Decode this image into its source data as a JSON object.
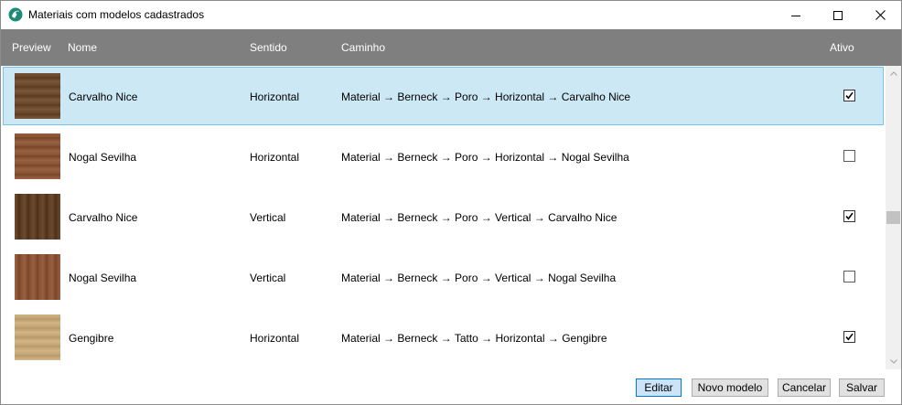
{
  "window": {
    "title": "Materiais com modelos cadastrados",
    "icon": "app-logo-icon"
  },
  "table": {
    "columns": {
      "preview": "Preview",
      "nome": "Nome",
      "sentido": "Sentido",
      "caminho": "Caminho",
      "ativo": "Ativo"
    },
    "rows": [
      {
        "nome": "Carvalho Nice",
        "sentido": "Horizontal",
        "caminho": "Material → Berneck → Poro → Horizontal → Carvalho Nice",
        "ativo": true,
        "selected": true,
        "swatch": "#6b4a2e"
      },
      {
        "nome": "Nogal Sevilha",
        "sentido": "Horizontal",
        "caminho": "Material → Berneck → Poro → Horizontal → Nogal Sevilha",
        "ativo": false,
        "selected": false,
        "swatch": "#8a5637"
      },
      {
        "nome": "Carvalho Nice",
        "sentido": "Vertical",
        "caminho": "Material → Berneck → Poro → Vertical → Carvalho Nice",
        "ativo": true,
        "selected": false,
        "swatch": "#5e3f25"
      },
      {
        "nome": "Nogal Sevilha",
        "sentido": "Vertical",
        "caminho": "Material → Berneck → Poro → Vertical → Nogal Sevilha",
        "ativo": false,
        "selected": false,
        "swatch": "#8b5437"
      },
      {
        "nome": "Gengibre",
        "sentido": "Horizontal",
        "caminho": "Material → Berneck → Tatto → Horizontal → Gengibre",
        "ativo": true,
        "selected": false,
        "swatch": "#c7a878"
      }
    ]
  },
  "footer": {
    "editar": "Editar",
    "novo_modelo": "Novo modelo",
    "cancelar": "Cancelar",
    "salvar": "Salvar"
  },
  "colors": {
    "header_bg": "#7f7f7f",
    "selected_row": "#cce8f5",
    "selected_border": "#74c4ee",
    "primary_button": "#cce4f7"
  }
}
